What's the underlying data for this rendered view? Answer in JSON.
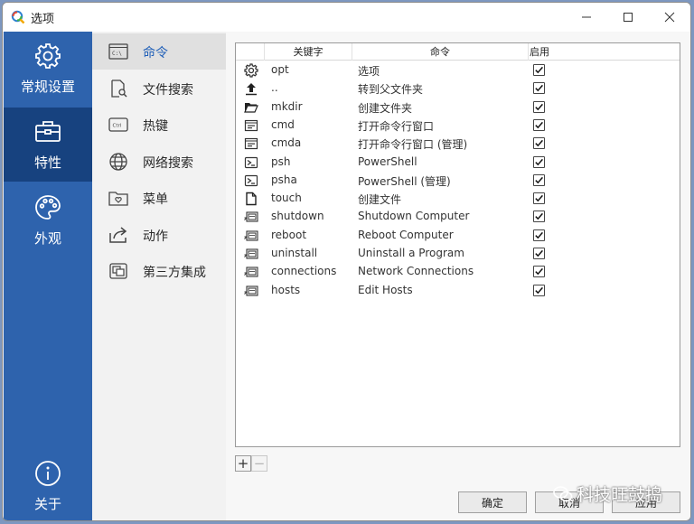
{
  "window": {
    "title": "选项",
    "app_icon": "search-logo-icon"
  },
  "colors": {
    "nav_bg": "#2e63ad",
    "nav_active": "#17427f",
    "subnav_active_text": "#1f5fb8"
  },
  "nav": {
    "items": [
      {
        "label": "常规设置",
        "icon": "gear-icon"
      },
      {
        "label": "特性",
        "icon": "toolbox-icon",
        "active": true
      },
      {
        "label": "外观",
        "icon": "palette-icon"
      },
      {
        "label": "关于",
        "icon": "info-icon"
      }
    ]
  },
  "subnav": {
    "items": [
      {
        "label": "命令",
        "icon": "console-icon",
        "active": true
      },
      {
        "label": "文件搜索",
        "icon": "file-search-icon"
      },
      {
        "label": "热键",
        "icon": "keyboard-key-icon"
      },
      {
        "label": "网络搜索",
        "icon": "globe-icon"
      },
      {
        "label": "菜单",
        "icon": "menu-folder-icon"
      },
      {
        "label": "动作",
        "icon": "share-arrow-icon"
      },
      {
        "label": "第三方集成",
        "icon": "integration-icon"
      }
    ]
  },
  "table": {
    "headers": {
      "key": "关键字",
      "command": "命令",
      "enabled": "启用"
    },
    "rows": [
      {
        "icon": "gear-icon",
        "key": "opt",
        "command": "选项",
        "enabled": true
      },
      {
        "icon": "upload-arrow-icon",
        "key": "..",
        "command": "转到父文件夹",
        "enabled": true
      },
      {
        "icon": "folder-open-icon",
        "key": "mkdir",
        "command": "创建文件夹",
        "enabled": true
      },
      {
        "icon": "console-window-icon",
        "key": "cmd",
        "command": "打开命令行窗口",
        "enabled": true
      },
      {
        "icon": "console-window-icon",
        "key": "cmda",
        "command": "打开命令行窗口 (管理)",
        "enabled": true
      },
      {
        "icon": "powershell-icon",
        "key": "psh",
        "command": "PowerShell",
        "enabled": true
      },
      {
        "icon": "powershell-icon",
        "key": "psha",
        "command": "PowerShell (管理)",
        "enabled": true
      },
      {
        "icon": "file-icon",
        "key": "touch",
        "command": "创建文件",
        "enabled": true
      },
      {
        "icon": "windows-shortcut-icon",
        "key": "shutdown",
        "command": "Shutdown Computer",
        "enabled": true
      },
      {
        "icon": "windows-shortcut-icon",
        "key": "reboot",
        "command": "Reboot Computer",
        "enabled": true
      },
      {
        "icon": "windows-shortcut-icon",
        "key": "uninstall",
        "command": "Uninstall a Program",
        "enabled": true
      },
      {
        "icon": "windows-shortcut-icon",
        "key": "connections",
        "command": "Network Connections",
        "enabled": true
      },
      {
        "icon": "windows-shortcut-icon",
        "key": "hosts",
        "command": "Edit Hosts",
        "enabled": true
      }
    ]
  },
  "toolbar": {
    "add": "+",
    "remove": "−"
  },
  "buttons": {
    "ok": "确定",
    "cancel": "取消",
    "apply": "应用"
  },
  "watermark": "科技旺鼓捣"
}
